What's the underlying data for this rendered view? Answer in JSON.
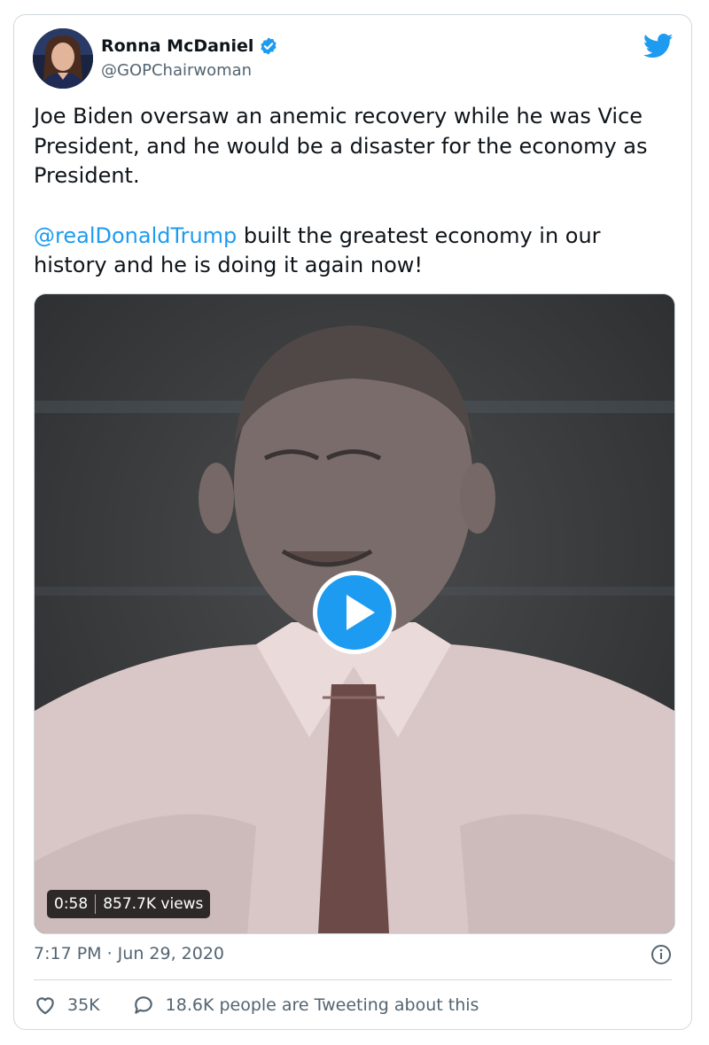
{
  "tweet": {
    "author_name": "Ronna McDaniel",
    "handle": "@GOPChairwoman",
    "text_line1": "Joe Biden oversaw an anemic recovery while he was Vice President, and he would be a disaster for the economy as President.",
    "mention": "@realDonaldTrump",
    "text_line2_rest": " built the greatest economy in our history and he is doing it again now!",
    "timestamp": "7:17 PM · Jun 29, 2020"
  },
  "video": {
    "duration": "0:58",
    "views": "857.7K views"
  },
  "stats": {
    "likes": "35K",
    "conversation": "18.6K people are Tweeting about this"
  },
  "colors": {
    "accent": "#1d9bf0",
    "text": "#0f1419",
    "muted": "#536471",
    "border": "#cfd9de"
  },
  "icons": [
    "verified-badge-icon",
    "twitter-bird-icon",
    "play-icon",
    "info-icon",
    "heart-icon",
    "speech-bubble-icon"
  ]
}
